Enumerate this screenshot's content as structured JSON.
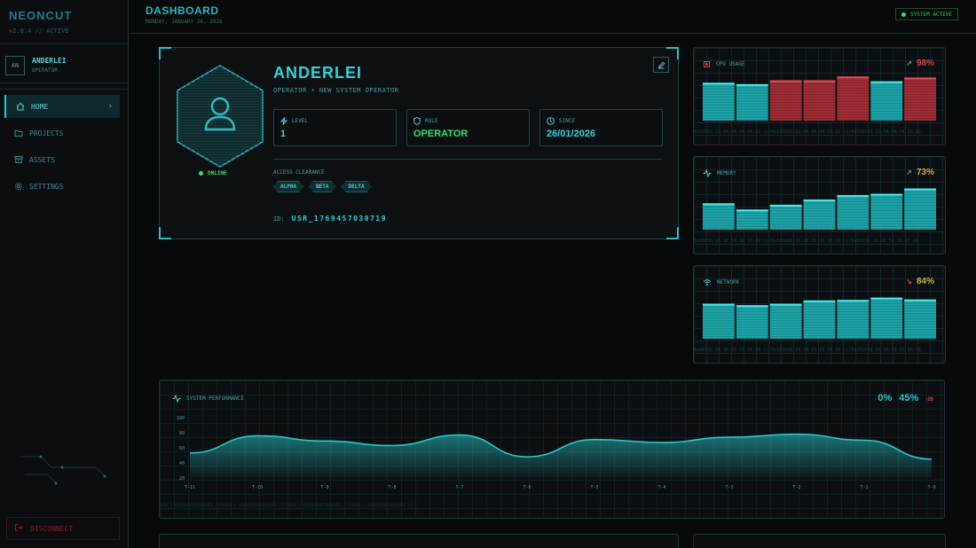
{
  "sidebar": {
    "brand": "NEONCUT",
    "version": "v2.0.4 // ACTIVE",
    "user": {
      "initials": "AN",
      "name": "ANDERLEI",
      "role": "OPERATOR"
    },
    "items": [
      {
        "label": "HOME",
        "icon": "home-icon",
        "active": true
      },
      {
        "label": "PROJECTS",
        "icon": "folder-icon"
      },
      {
        "label": "ASSETS",
        "icon": "archive-icon"
      },
      {
        "label": "SETTINGS",
        "icon": "gear-icon"
      }
    ],
    "disconnect": "DISCONNECT"
  },
  "header": {
    "title": "DASHBOARD",
    "date": "MONDAY, JANUARY 26, 2026",
    "status": "SYSTEM ACTIVE"
  },
  "profile": {
    "name": "ANDERLEI",
    "subtitle": "OPERATOR • NEW SYSTEM OPERATOR",
    "status": "ONLINE",
    "stats": [
      {
        "label": "LEVEL",
        "value": "1",
        "color": "#2fd3d6"
      },
      {
        "label": "ROLE",
        "value": "OPERATOR",
        "color": "#35e06a"
      },
      {
        "label": "SINCE",
        "value": "26/01/2026",
        "color": "#2fd3d6"
      }
    ],
    "clearance_label": "ACCESS CLEARANCE",
    "clearance": [
      "ALPHA",
      "BETA",
      "DELTA"
    ],
    "id_label": "ID:",
    "id": "USR_1769457030719"
  },
  "metrics": [
    {
      "name": "CPU USAGE",
      "value": "98%",
      "trend": "↗",
      "color": "#d8444a",
      "values": [
        0.79,
        0.76,
        0.84,
        0.84,
        0.92,
        0.82,
        0.9
      ],
      "alert": [
        false,
        false,
        true,
        true,
        true,
        false,
        true
      ],
      "hex": "0x03E9S 52 5A 5A 54 50 62 ///0x03E0S5 52 5A 5A 54 50 62 ///0x03E9S5 52 5A 5A 54 50 62"
    },
    {
      "name": "MEMORY",
      "value": "73%",
      "trend": "↗",
      "color": "#c9b24a",
      "values": [
        0.55,
        0.42,
        0.52,
        0.63,
        0.72,
        0.75,
        0.86
      ],
      "alert": [
        false,
        false,
        false,
        false,
        false,
        false,
        false
      ],
      "hex": "0x03C3D 20 2E 54 3D 37 49 ///0x0A2A3D 26 2E 3D 30 3F 49 ///0x03C3D 20 2E 54 3D 37 49"
    },
    {
      "name": "NETWORK",
      "value": "84%",
      "trend": "↘",
      "color": "#c9b24a",
      "values": [
        0.73,
        0.7,
        0.73,
        0.8,
        0.81,
        0.86,
        0.82
      ],
      "alert": [
        false,
        false,
        false,
        false,
        false,
        false,
        false
      ],
      "hex": "0x0E506 09 4B 53 53 50 56 ///0x0E2D98 09 4B 53 53 50 56 ///0x0E2D98 09 4B 53 53 50 56"
    }
  ],
  "performance": {
    "title": "SYSTEM PERFORMANCE",
    "v1": "0%",
    "v2": "45%",
    "v3": "-26",
    "hex": "0x0F C   66D6464E8C6D8464E8 ///0x0AA_C   66D6464E8C6D8464E8 ///0x0AA_C   66D6464E8C6D8464E8 ///0x0AA_C   66D6464E8C6D8464E8 ///"
  },
  "chart_data": {
    "type": "area",
    "title": "SYSTEM PERFORMANCE",
    "x": [
      "T-11",
      "T-10",
      "T-9",
      "T-8",
      "T-7",
      "T-6",
      "T-5",
      "T-4",
      "T-3",
      "T-2",
      "T-1",
      "T-0"
    ],
    "y": [
      53,
      76,
      69,
      63,
      77,
      48,
      71,
      67,
      74,
      78,
      70,
      45
    ],
    "yticks": [
      100,
      80,
      60,
      40,
      20
    ],
    "ylim": [
      20,
      100
    ],
    "color": "#29c7c9"
  }
}
